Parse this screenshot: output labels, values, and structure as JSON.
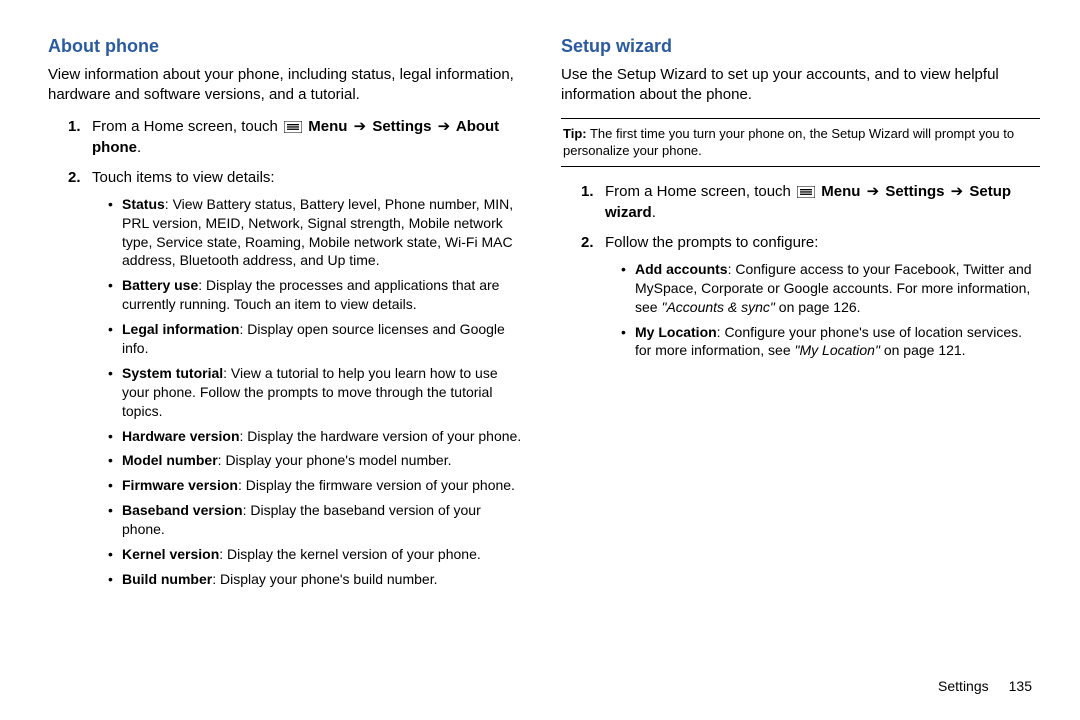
{
  "left": {
    "heading": "About phone",
    "intro": "View information about your phone, including status, legal information, hardware and software versions, and a tutorial.",
    "step1_a": "From a Home screen, touch ",
    "step1_menu": " Menu ",
    "step1_arrow": "➔",
    "step1_settings": " Settings ",
    "step1_about": " About phone",
    "step1_end": ".",
    "step2": "Touch items to view details:",
    "bullets": {
      "status": {
        "t": "Status",
        "d": ": View Battery status, Battery level, Phone number, MIN, PRL version, MEID, Network, Signal strength, Mobile network type, Service state, Roaming, Mobile network state, Wi-Fi MAC address, Bluetooth address, and Up time."
      },
      "battery": {
        "t": "Battery use",
        "d": ": Display the processes and applications that are currently running. Touch an item to view details."
      },
      "legal": {
        "t": "Legal information",
        "d": ": Display open source licenses and Google info."
      },
      "tutorial": {
        "t": "System  tutorial",
        "d": ": View a tutorial to help you learn how to use your phone. Follow the prompts to move through the tutorial topics."
      },
      "hw": {
        "t": "Hardware version",
        "d": ": Display the hardware version of your phone."
      },
      "model": {
        "t": "Model number",
        "d": ": Display your phone's model number."
      },
      "fw": {
        "t": "Firmware version",
        "d": ": Display the firmware version of your phone."
      },
      "bb": {
        "t": "Baseband version",
        "d": ": Display the baseband version of your phone."
      },
      "kernel": {
        "t": "Kernel version",
        "d": ": Display the kernel version of your phone."
      },
      "build": {
        "t": "Build number",
        "d": ": Display your phone's build number."
      }
    }
  },
  "right": {
    "heading": "Setup wizard",
    "intro": "Use the Setup Wizard to set up your accounts, and to view helpful information about the phone.",
    "tip_label": "Tip:",
    "tip_text": " The first time you turn your phone on, the Setup Wizard will prompt you to personalize your phone.",
    "step1_a": "From a Home screen, touch ",
    "step1_menu": " Menu ",
    "step1_arrow": "➔",
    "step1_settings": " Settings ",
    "step1_setup": " Setup wizard",
    "step1_end": ".",
    "step2": "Follow the prompts to configure:",
    "bullets": {
      "add": {
        "t": "Add accounts",
        "d1": ": Configure access to your Facebook, Twitter and MySpace, Corporate or Google accounts. For more information, see ",
        "ref": "\"Accounts & sync\"",
        "d2": " on page 126."
      },
      "loc": {
        "t": "My Location",
        "d1": ": Configure your phone's use of location services. for more information, see ",
        "ref": "\"My Location\"",
        "d2": " on page 121."
      }
    }
  },
  "footer": {
    "section": "Settings",
    "page": "135"
  }
}
